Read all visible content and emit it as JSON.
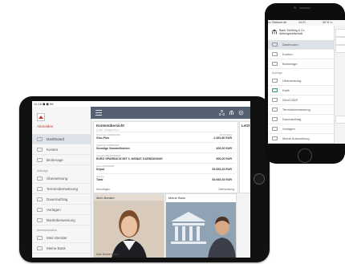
{
  "tablet": {
    "status_left": "12:16 ◼ ◼ 96",
    "sidebar": {
      "logout": "Abmelden",
      "items": [
        {
          "label": "Dashboard",
          "icon": "dashboard-icon",
          "active": true
        },
        {
          "label": "Konten",
          "icon": "list-icon"
        },
        {
          "label": "Brokerage",
          "icon": "chart-icon"
        }
      ],
      "section_auftraege": "Aufträge",
      "auftraege": [
        {
          "label": "Überweisung",
          "icon": "transfer-icon"
        },
        {
          "label": "Terminüberweisung",
          "icon": "calendar-icon"
        },
        {
          "label": "Dauerauftrag",
          "icon": "repeat-icon"
        },
        {
          "label": "Vorlagen",
          "icon": "template-icon"
        },
        {
          "label": "Banküberweisung",
          "icon": "bank-icon"
        }
      ],
      "section_kommunikation": "Kommunikation",
      "kommunikation": [
        {
          "label": "Mein Berater",
          "icon": "person-icon"
        },
        {
          "label": "Meine Bank",
          "icon": "bank-icon"
        }
      ]
    },
    "kontenuebersicht": {
      "title": "Kontenübersicht",
      "subtitle": "[ ] 111 · Postgiro Kon...",
      "rows": [
        {
          "l1": "Giro-Konto 0000000000",
          "l2": "Giro-Plus",
          "r1": "30.000 EUR",
          "r2": "2.381,80 EUR"
        },
        {
          "l1": "Sparbuch 0000000000",
          "l2": "Sonstige Sammelkonten",
          "r1": "",
          "r2": "400,00 EUR"
        },
        {
          "l1": "Festgeld 000000000000",
          "l2": "EURO SPARBUCH MIT 3. MONAT. KUENDIGUNG",
          "r1": "",
          "r2": "900,00 EUR"
        },
        {
          "l1": "Depot 000000000",
          "l2": "Depot",
          "r1": "",
          "r2": "53.665,33 EUR"
        },
        {
          "l1": "Summe",
          "l2": "Total",
          "r1": "",
          "r2": "53.665,33 EUR"
        }
      ],
      "foot_left": "Hinzufügen",
      "foot_right": "Überweisung"
    },
    "second_card_title": "Letzt",
    "mein_berater": {
      "title": "Mein Berater",
      "caption": "Max Mustermann"
    },
    "meine_bank": {
      "title": "Meine Bank"
    }
  },
  "phone": {
    "status_left": "••• Telekom.de",
    "status_time": "14:21",
    "status_right": "49 % ▭",
    "bank_name_line1": "Bank Schilling & Co",
    "bank_name_line2": "Aktiengesellschaft",
    "items": [
      {
        "label": "Dashboard",
        "icon": "dashboard-icon",
        "active": true
      },
      {
        "label": "Konten",
        "icon": "list-icon"
      },
      {
        "label": "Brokerage",
        "icon": "chart-icon"
      }
    ],
    "section_auftraege": "Aufträge",
    "auftraege": [
      {
        "label": "Überweisung",
        "icon": "transfer-icon"
      },
      {
        "label": "Kwitt",
        "icon": "kwitt-icon"
      },
      {
        "label": "GiroCODE",
        "icon": "qr-icon"
      },
      {
        "label": "Terminüberweisung",
        "icon": "calendar-icon"
      },
      {
        "label": "Dauerauftrag",
        "icon": "repeat-icon"
      },
      {
        "label": "Vorlagen",
        "icon": "template-icon"
      },
      {
        "label": "Meine Auswahlung",
        "icon": "bank-icon"
      }
    ]
  }
}
